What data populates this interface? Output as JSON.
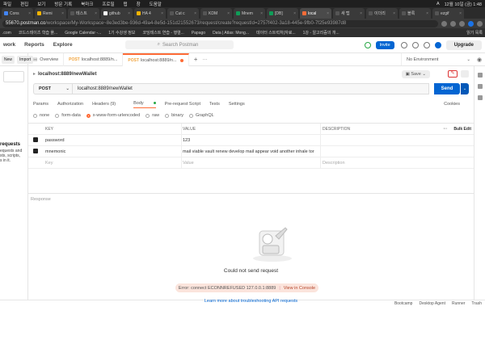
{
  "macbar": {
    "menus": [
      "파일",
      "편집",
      "보기",
      "방문 기록",
      "북마크",
      "프로필",
      "탭",
      "창",
      "도움말"
    ],
    "status_right": [
      "A",
      "12월 10일 (금) 1:48"
    ]
  },
  "browser_tabs": [
    {
      "label": "Cons",
      "color": "#4285f4",
      "active": false
    },
    {
      "label": "Remi",
      "color": "#f4b400",
      "active": false
    },
    {
      "label": "테스트",
      "color": "#555",
      "active": false
    },
    {
      "label": "github",
      "color": "#fff",
      "active": false
    },
    {
      "label": "HA 4",
      "color": "#f4b400",
      "active": false
    },
    {
      "label": "Cut c",
      "color": "#555",
      "active": false
    },
    {
      "label": "KDM",
      "color": "#555",
      "active": false
    },
    {
      "label": "Mnem",
      "color": "#0f9d58",
      "active": false
    },
    {
      "label": "[DB]",
      "color": "#0f9d58",
      "active": false
    },
    {
      "label": "local",
      "color": "#ff6c37",
      "active": true
    },
    {
      "label": "새 탭",
      "color": "#555",
      "active": false
    },
    {
      "label": "이더리",
      "color": "#555",
      "active": false
    },
    {
      "label": "블록",
      "color": "#555",
      "active": false
    },
    {
      "label": "ezgif",
      "color": "#555",
      "active": false
    }
  ],
  "address": {
    "host": "55670.postman.co",
    "path": "/workspace/My-Workspace~8e3ed3be-936d-49a4-8e5d-151d21552673/request/create?requestId=2757f402-3a18-445e-9fb0-7f25e93987d8"
  },
  "bookmarks": [
    ".com",
    "코드스테이츠 학습 플...",
    "Google Calendar -...",
    "1기 수강생 정보",
    "코딩테스트 연습 - 행렬...",
    "Papago",
    "Data | Atlas: Mong...",
    "데이터 스트럭처(자료...",
    "1강 - 알고리즘의 개...",
    "읽기 목록"
  ],
  "pm_header": {
    "nav": [
      "work",
      "Reports",
      "Explore"
    ],
    "search_placeholder": "Search Postman",
    "invite": "Invite",
    "upgrade": "Upgrade"
  },
  "workbar": {
    "new": "New",
    "import": "Import",
    "tabs": [
      {
        "method": "POST",
        "label": "Overview",
        "plain": true
      },
      {
        "method": "POST",
        "label": "localhost:8889/n...",
        "plain": false
      },
      {
        "method": "POST",
        "label": "localhost:8889/n...",
        "plain": false,
        "active": true
      }
    ],
    "plus": "+",
    "more": "···",
    "environment": "No Environment"
  },
  "sidebar": {
    "heading": "requests",
    "lines": [
      "equests and",
      "sts, scripts,",
      "s in it."
    ]
  },
  "request": {
    "title": "localhost:8889/newWallet",
    "save": "Save",
    "method": "POST",
    "url": "localhost:8889/newWallet",
    "send": "Send",
    "tabs": [
      "Params",
      "Authorization",
      "Headers (9)",
      "Body",
      "Pre-request Script",
      "Tests",
      "Settings"
    ],
    "cookies": "Cookies",
    "body_types": [
      "none",
      "form-data",
      "x-www-form-urlencoded",
      "raw",
      "binary",
      "GraphQL"
    ],
    "selected_body_type": "x-www-form-urlencoded"
  },
  "kv_table": {
    "headers": {
      "key": "KEY",
      "value": "VALUE",
      "desc": "DESCRIPTION",
      "more": "···",
      "bulk": "Bulk Edit"
    },
    "rows": [
      {
        "key": "password",
        "value": "123",
        "desc": ""
      },
      {
        "key": "mnemonic",
        "value": "mail viable vault renew develop mail appear void another inhale tor",
        "desc": ""
      }
    ],
    "placeholder": {
      "key": "Key",
      "value": "Value",
      "desc": "Description"
    }
  },
  "response": {
    "label": "Response",
    "error_title": "Could not send request",
    "error_detail": "Error: connect ECONNREFUSED 127.0.0.1:8889",
    "view_console": "View in Console",
    "learn_more": "Learn more about troubleshooting API requests"
  },
  "footer": [
    "Bootcamp",
    "Desktop Agent",
    "Runner",
    "Trash"
  ]
}
